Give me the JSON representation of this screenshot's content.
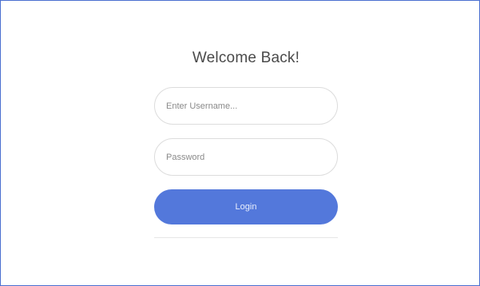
{
  "login": {
    "title": "Welcome Back!",
    "username_placeholder": "Enter Username...",
    "username_value": "",
    "password_placeholder": "Password",
    "password_value": "",
    "login_label": "Login"
  },
  "colors": {
    "frame_border": "#4a6fd0",
    "button_bg": "#5378db",
    "field_border": "#dcdcdc"
  }
}
